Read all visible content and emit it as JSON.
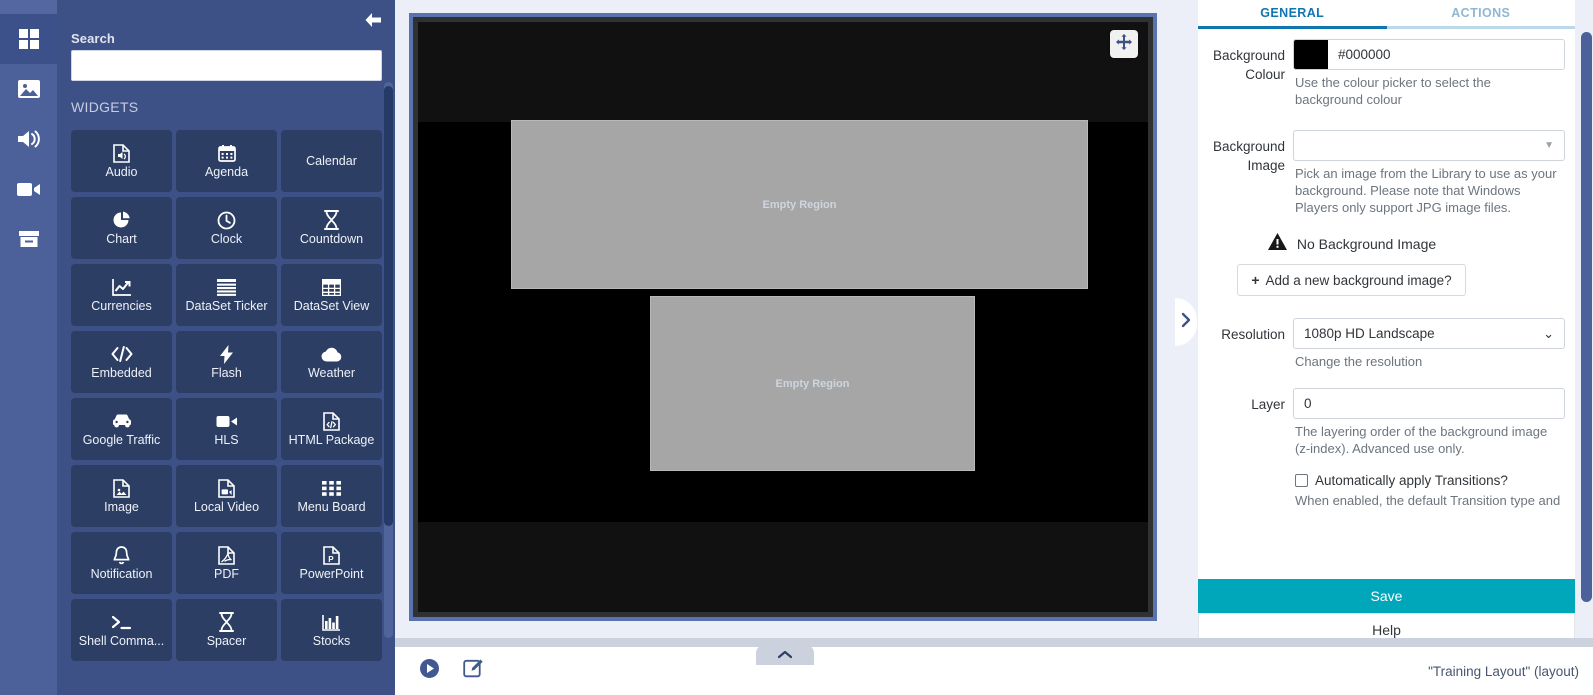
{
  "rail": {
    "items": [
      {
        "name": "layouts",
        "icon": "grid-icon",
        "active": true
      },
      {
        "name": "library-images",
        "icon": "image-icon",
        "active": false
      },
      {
        "name": "audio",
        "icon": "speaker-icon",
        "active": false
      },
      {
        "name": "video",
        "icon": "video-camera-icon",
        "active": false
      },
      {
        "name": "archive",
        "icon": "archive-box-icon",
        "active": false
      }
    ]
  },
  "sidebar": {
    "back_arrow_icon": "arrow-left-icon",
    "search_label": "Search",
    "search_value": "",
    "search_placeholder": "",
    "section_title": "WIDGETS",
    "widgets": [
      {
        "label": "Audio",
        "icon": "audio-file-icon"
      },
      {
        "label": "Agenda",
        "icon": "calendar-grid-icon"
      },
      {
        "label": "Calendar",
        "icon": ""
      },
      {
        "label": "Chart",
        "icon": "pie-chart-icon"
      },
      {
        "label": "Clock",
        "icon": "clock-icon"
      },
      {
        "label": "Countdown",
        "icon": "hourglass-icon"
      },
      {
        "label": "Currencies",
        "icon": "line-chart-icon"
      },
      {
        "label": "DataSet Ticker",
        "icon": "list-lines-icon"
      },
      {
        "label": "DataSet View",
        "icon": "table-grid-icon"
      },
      {
        "label": "Embedded",
        "icon": "code-brackets-icon"
      },
      {
        "label": "Flash",
        "icon": "lightning-bolt-icon"
      },
      {
        "label": "Weather",
        "icon": "cloud-icon"
      },
      {
        "label": "Google Traffic",
        "icon": "car-icon"
      },
      {
        "label": "HLS",
        "icon": "video-camera-icon"
      },
      {
        "label": "HTML Package",
        "icon": "html-file-icon"
      },
      {
        "label": "Image",
        "icon": "image-file-icon"
      },
      {
        "label": "Local Video",
        "icon": "video-file-icon"
      },
      {
        "label": "Menu Board",
        "icon": "dots-grid-icon"
      },
      {
        "label": "Notification",
        "icon": "bell-icon"
      },
      {
        "label": "PDF",
        "icon": "pdf-file-icon"
      },
      {
        "label": "PowerPoint",
        "icon": "powerpoint-file-icon"
      },
      {
        "label": "Shell Comma...",
        "icon": "terminal-icon"
      },
      {
        "label": "Spacer",
        "icon": "hourglass-icon"
      },
      {
        "label": "Stocks",
        "icon": "bar-chart-icon"
      }
    ]
  },
  "canvas": {
    "move_handle_icon": "move-arrows-icon",
    "background_colour": "#000000",
    "regions": [
      {
        "label": "Empty Region"
      },
      {
        "label": "Empty Region"
      }
    ],
    "collapse_tab_icon": "chevron-up-icon"
  },
  "bottom_bar": {
    "play_icon": "play-circle-icon",
    "edit_icon": "edit-pencil-icon"
  },
  "panel": {
    "tabs": [
      {
        "label": "GENERAL",
        "active": true
      },
      {
        "label": "ACTIONS",
        "active": false
      }
    ],
    "expand_handle_icon": "chevron-right-icon",
    "background_colour": {
      "label": "Background Colour",
      "value": "#000000",
      "swatch_hex": "#000000",
      "help": "Use the colour picker to select the background colour"
    },
    "background_image": {
      "label": "Background Image",
      "value": "",
      "caret_icon": "caret-down-icon",
      "help": "Pick an image from the Library to use as your background. Please note that Windows Players only support JPG image files.",
      "warning_icon": "warning-triangle-icon",
      "warning_text": "No Background Image",
      "add_button_label": "Add a new background image?",
      "add_button_icon": "plus-icon"
    },
    "resolution": {
      "label": "Resolution",
      "value": "1080p HD Landscape",
      "caret_icon": "chevron-down-icon",
      "help": "Change the resolution"
    },
    "layer": {
      "label": "Layer",
      "value": "0",
      "help": "The layering order of the background image (z-index). Advanced use only."
    },
    "transitions": {
      "checkbox_label": "Automatically apply Transitions?",
      "checked": false,
      "help": "When enabled, the default Transition type and"
    },
    "save_label": "Save",
    "help_label": "Help"
  },
  "status": {
    "text": "\"Training Layout\" (layout)"
  },
  "colors": {
    "rail_bg": "#4c6099",
    "sidebar_bg": "#3d5186",
    "tile_bg": "#2c3e63",
    "accent_tab": "#1175b0",
    "save_btn": "#00a6b9",
    "canvas_border": "#5873ad",
    "region_fill": "#a6a6a6"
  }
}
